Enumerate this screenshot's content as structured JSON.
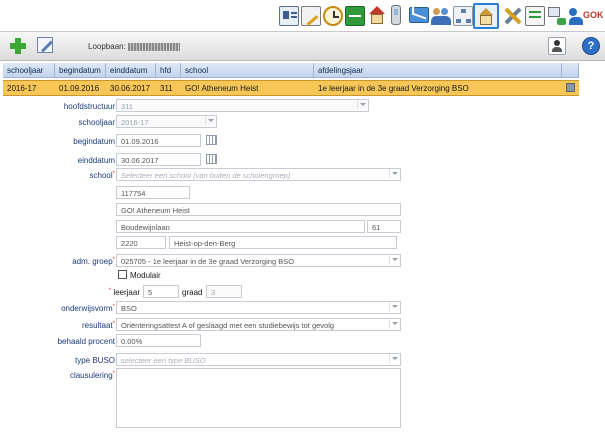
{
  "toolbar": {
    "title_label": "Loopbaan:",
    "title_value": "Ba_ _ _ _ _ _ _ _ _"
  },
  "table": {
    "columns": [
      "schooljaar",
      "begindatum",
      "einddatum",
      "hfd",
      "school",
      "afdelingsjaar"
    ],
    "row": {
      "schooljaar": "2016-17",
      "begindatum": "01.09.2016",
      "einddatum": "30.06.2017",
      "hfd": "311",
      "school": "GO! Atheneum Heist",
      "afdelingsjaar": "1e leerjaar in de 3e graad Verzorging BSO"
    }
  },
  "form": {
    "hoofdstructuur": {
      "label": "hoofdstructuur",
      "value": "311"
    },
    "schooljaar": {
      "label": "schooljaar",
      "value": "2016-17"
    },
    "begindatum": {
      "label": "begindatum",
      "value": "01.09.2016"
    },
    "einddatum": {
      "label": "einddatum",
      "value": "30.06.2017"
    },
    "school": {
      "label": "school",
      "placeholder": "Selecteer een school (van buiten de scholengroep)",
      "number": "117754",
      "name": "GO! Atheneum Heist",
      "street": "Boudewijnlaan",
      "housenr": "61",
      "postcode": "2220",
      "city": "Heist-op-den-Berg"
    },
    "adm_groep": {
      "label": "adm. groep",
      "value": "025705 - 1e leerjaar in de 3e graad Verzorging BSO"
    },
    "modulair": {
      "label": "Modulair"
    },
    "leerjaar": {
      "label": "leerjaar",
      "value": "5"
    },
    "graad": {
      "label": "graad",
      "value": "3"
    },
    "onderwijsvorm": {
      "label": "onderwijsvorm",
      "value": "BSO"
    },
    "resultaat": {
      "label": "resultaat",
      "value": "Oriënteringsattest A of geslaagd met een studiebewijs tot gevolg"
    },
    "behaald_procent": {
      "label": "behaald procent",
      "value": "0.00%"
    },
    "type_buso": {
      "label": "type BUSO",
      "placeholder": "selecteer een type BUSO"
    },
    "clausulering": {
      "label": "clausulering"
    }
  },
  "required_mark": "*",
  "top_icons": [
    "contact-card-icon",
    "notepad-icon",
    "clock-icon",
    "green-panel-icon",
    "house-icon",
    "phone-icon",
    "mail-icon",
    "people-icon",
    "org-chart-icon",
    "school-house-icon",
    "tools-icon",
    "report-icon",
    "network-icon",
    "user-logout-icon"
  ],
  "colors": {
    "selected_row": "#f6c657",
    "header": "#c9d8ee",
    "accent": "#2a7fd4"
  }
}
